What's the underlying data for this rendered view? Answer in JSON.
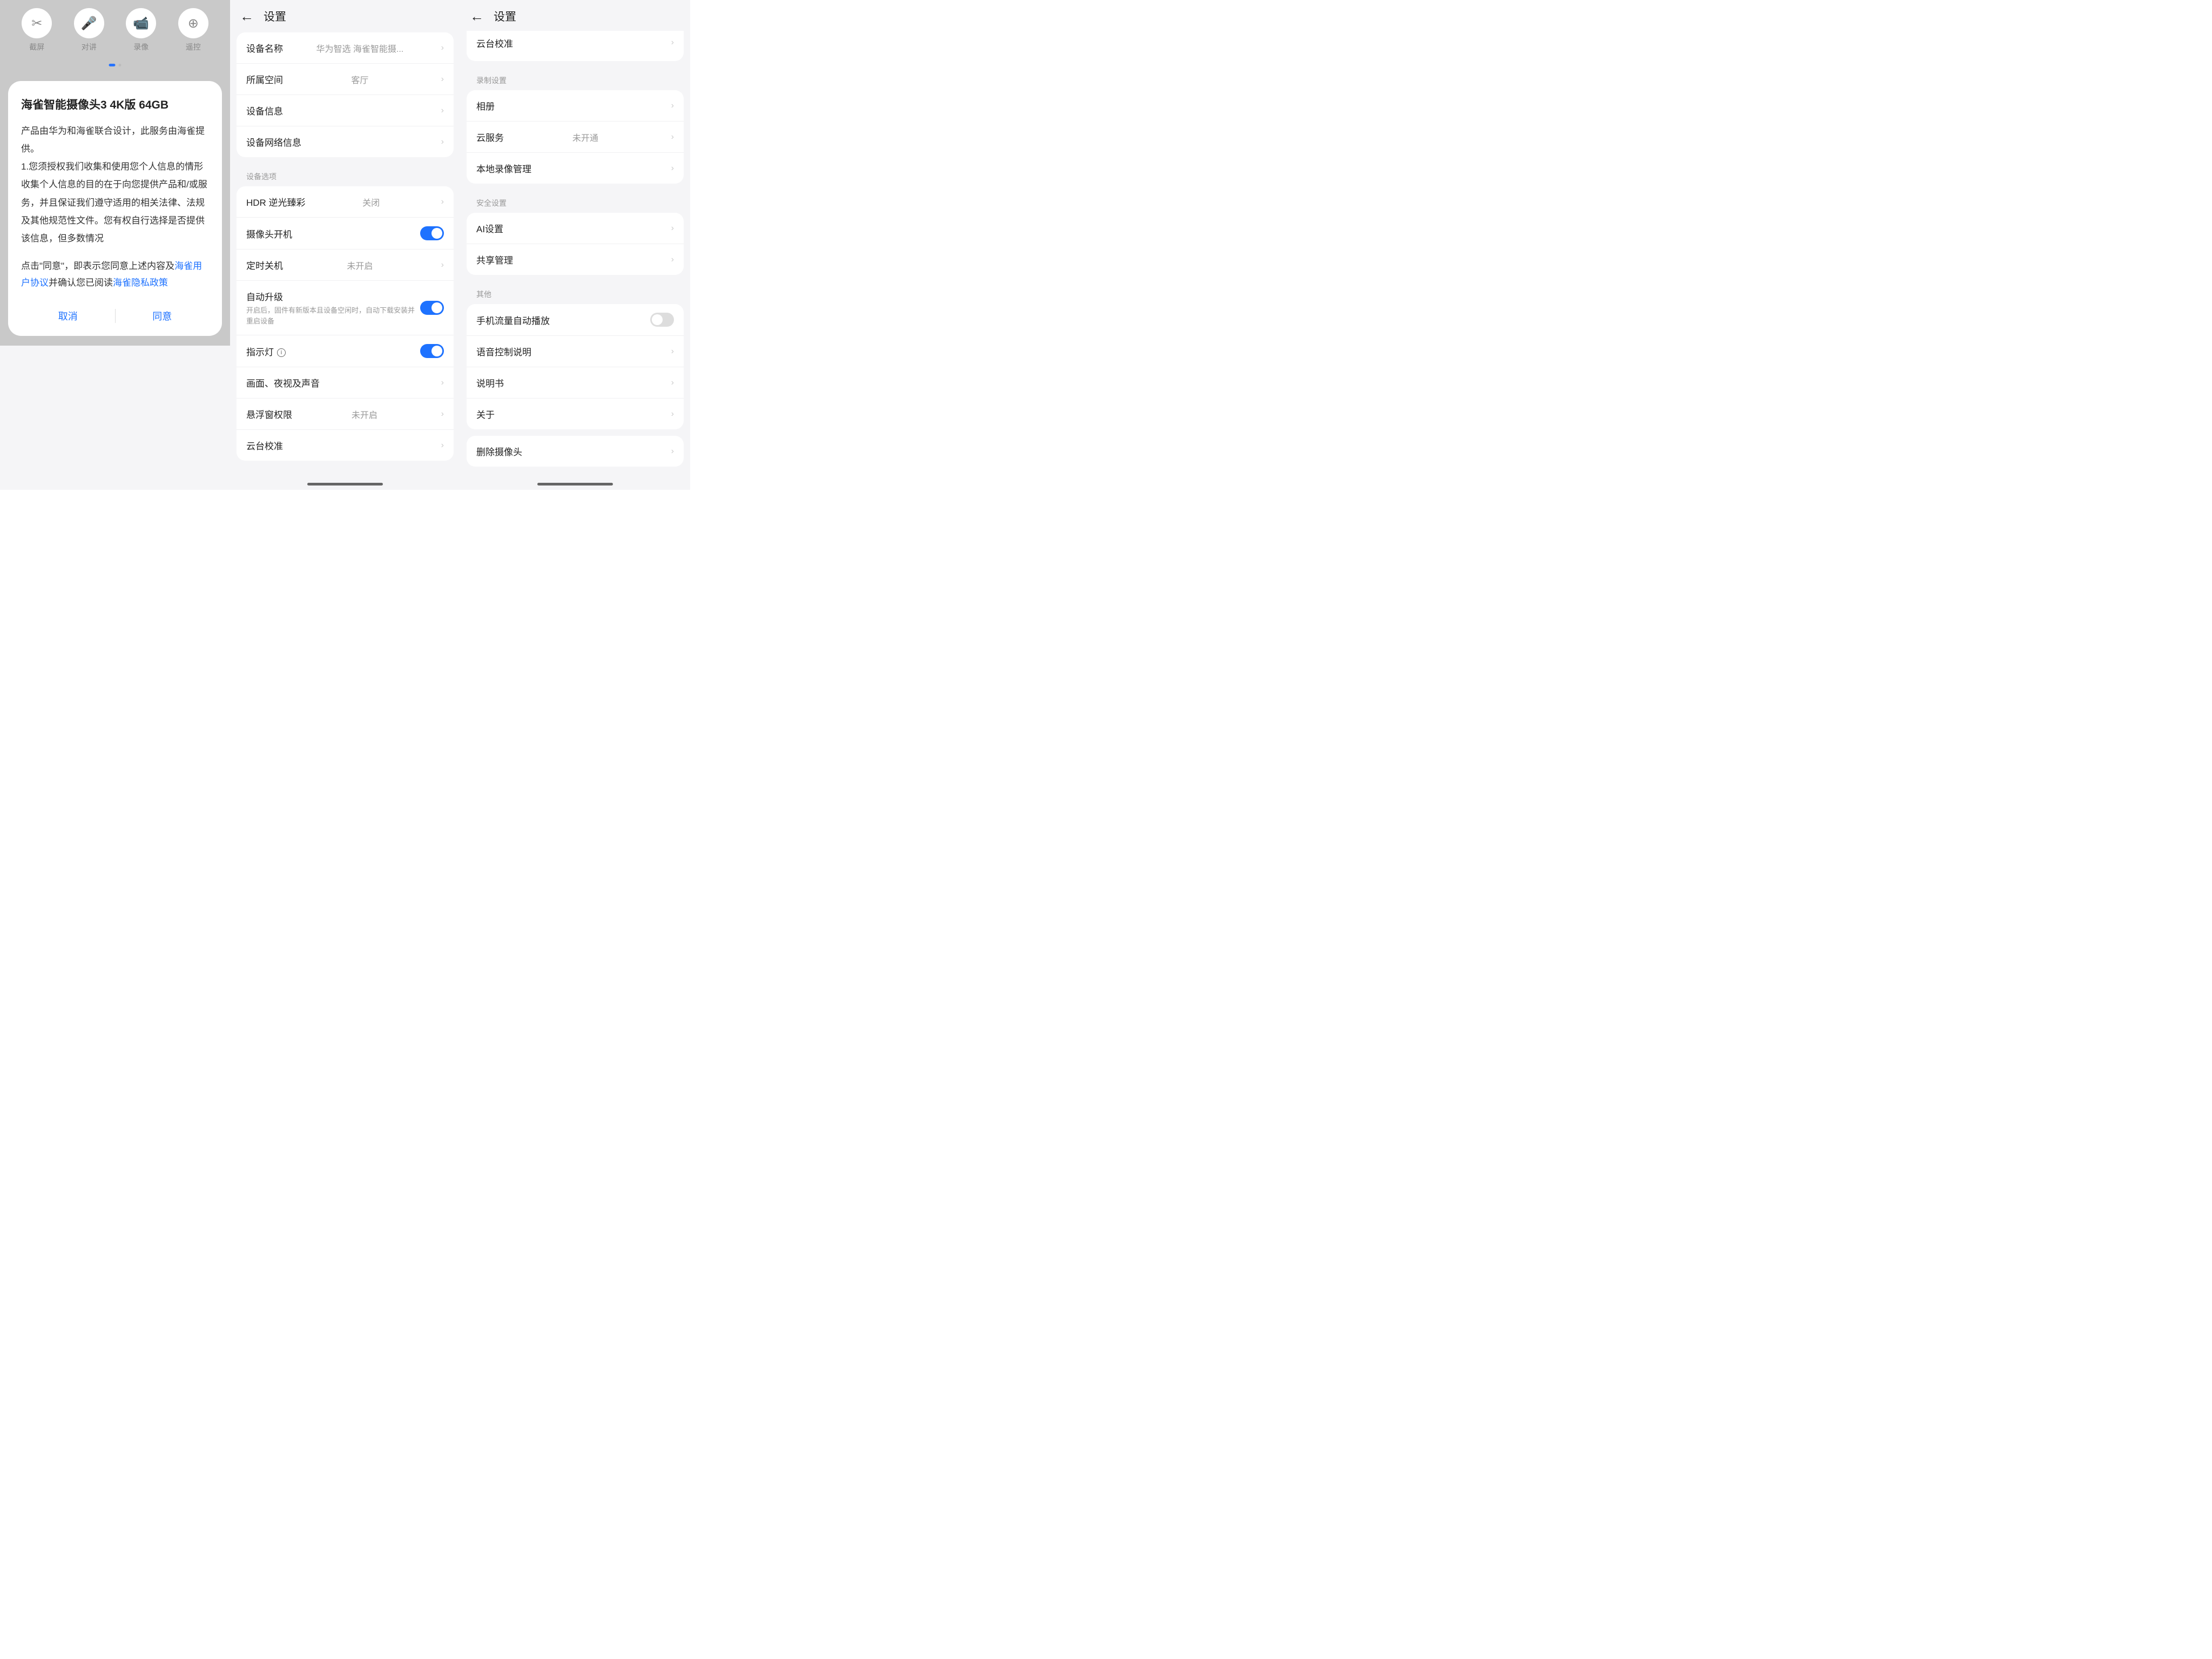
{
  "screen1": {
    "toolbar": [
      {
        "label": "截屏",
        "icon": "✂"
      },
      {
        "label": "对讲",
        "icon": "🎤"
      },
      {
        "label": "录像",
        "icon": "📹"
      },
      {
        "label": "遥控",
        "icon": "⊕"
      }
    ],
    "modal": {
      "title": "海雀智能摄像头3 4K版 64GB",
      "body_intro": "产品由华为和海雀联合设计，此服务由海雀提供。",
      "body_section_title": "1.您须授权我们收集和使用您个人信息的情形",
      "body_para": "收集个人信息的目的在于向您提供产品和/或服务，并且保证我们遵守适用的相关法律、法规及其他规范性文件。您有权自行选择是否提供该信息，但多数情况",
      "footer_pre": "点击\"同意\"，即表示您同意上述内容及",
      "link1": "海雀用户协议",
      "footer_mid": "并确认您已阅读",
      "link2": "海雀隐私政策",
      "cancel": "取消",
      "agree": "同意"
    }
  },
  "screen2": {
    "header_title": "设置",
    "rows": {
      "device_name": {
        "label": "设备名称",
        "value": "华为智选 海雀智能摄..."
      },
      "space": {
        "label": "所属空间",
        "value": "客厅"
      },
      "device_info": {
        "label": "设备信息"
      },
      "network_info": {
        "label": "设备网络信息"
      }
    },
    "section_device_options": "设备选项",
    "options": {
      "hdr": {
        "label": "HDR 逆光臻彩",
        "value": "关闭"
      },
      "camera_on": {
        "label": "摄像头开机"
      },
      "timer_off": {
        "label": "定时关机",
        "value": "未开启"
      },
      "auto_upgrade": {
        "label": "自动升级",
        "sub": "开启后，固件有新版本且设备空闲时，自动下载安装并重启设备"
      },
      "indicator": {
        "label": "指示灯"
      },
      "picture_night": {
        "label": "画面、夜视及声音"
      },
      "float_window": {
        "label": "悬浮窗权限",
        "value": "未开启"
      },
      "gimbal": {
        "label": "云台校准"
      }
    }
  },
  "screen3": {
    "header_title": "设置",
    "partial_top": "云台校准",
    "section_record": "录制设置",
    "record": {
      "album": {
        "label": "相册"
      },
      "cloud": {
        "label": "云服务",
        "value": "未开通"
      },
      "local_rec": {
        "label": "本地录像管理"
      }
    },
    "section_security": "安全设置",
    "security": {
      "ai": {
        "label": "AI设置"
      },
      "share": {
        "label": "共享管理"
      }
    },
    "section_other": "其他",
    "other": {
      "mobile_play": {
        "label": "手机流量自动播放"
      },
      "voice_ctrl": {
        "label": "语音控制说明"
      },
      "manual": {
        "label": "说明书"
      },
      "about": {
        "label": "关于"
      }
    },
    "delete": {
      "label": "删除摄像头"
    }
  }
}
